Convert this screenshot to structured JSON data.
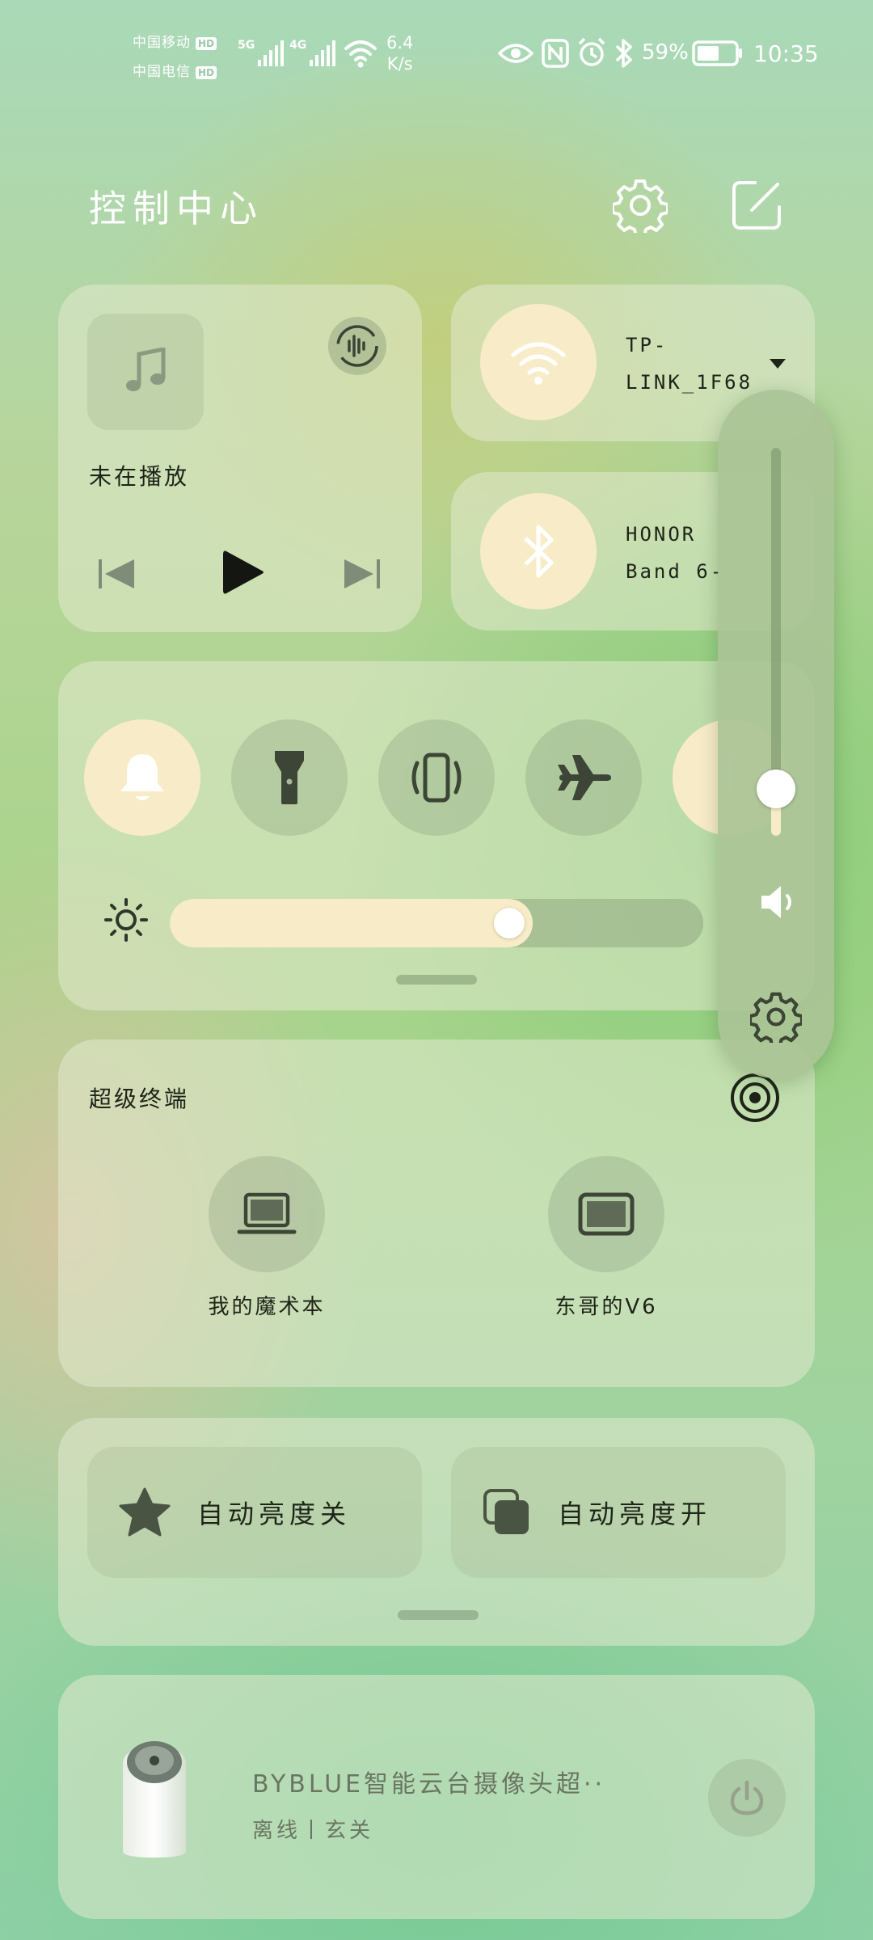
{
  "status_bar": {
    "carrier1": "中国移动",
    "carrier2": "中国电信",
    "hd": "HD",
    "net1": "5G",
    "net2": "4G",
    "speed_value": "6.4",
    "speed_unit": "K/s",
    "battery": "59%",
    "time": "10:35"
  },
  "header": {
    "title": "控制中心",
    "settings_icon": "gear-icon",
    "edit_icon": "edit-icon"
  },
  "media": {
    "status": "未在播放"
  },
  "wifi": {
    "name_line1": "TP-",
    "name_line2": "LINK_1F68",
    "enabled": true
  },
  "bluetooth": {
    "device_line1": "HONOR",
    "device_line2": "Band 6-",
    "enabled": true
  },
  "toggles": [
    {
      "icon": "bell-icon",
      "on": true
    },
    {
      "icon": "flashlight-icon",
      "on": false
    },
    {
      "icon": "vibrate-icon",
      "on": false
    },
    {
      "icon": "airplane-icon",
      "on": false
    },
    {
      "icon": "unknown-icon",
      "on": true
    }
  ],
  "brightness": {
    "level": 0.68
  },
  "volume": {
    "level": 0.12
  },
  "super_device": {
    "title": "超级终端",
    "devices": [
      {
        "name": "我的魔术本",
        "icon": "laptop-icon"
      },
      {
        "name": "东哥的V6",
        "icon": "tablet-icon"
      }
    ]
  },
  "shortcuts": [
    {
      "label": "自动亮度关",
      "icon": "star-icon"
    },
    {
      "label": "自动亮度开",
      "icon": "copy-icon"
    }
  ],
  "smart_device": {
    "name": "BYBLUE智能云台摄像头超··",
    "status": "离线丨玄关"
  },
  "colors": {
    "active_circle": "#f8ecc8",
    "inactive_circle": "#a9b896"
  }
}
